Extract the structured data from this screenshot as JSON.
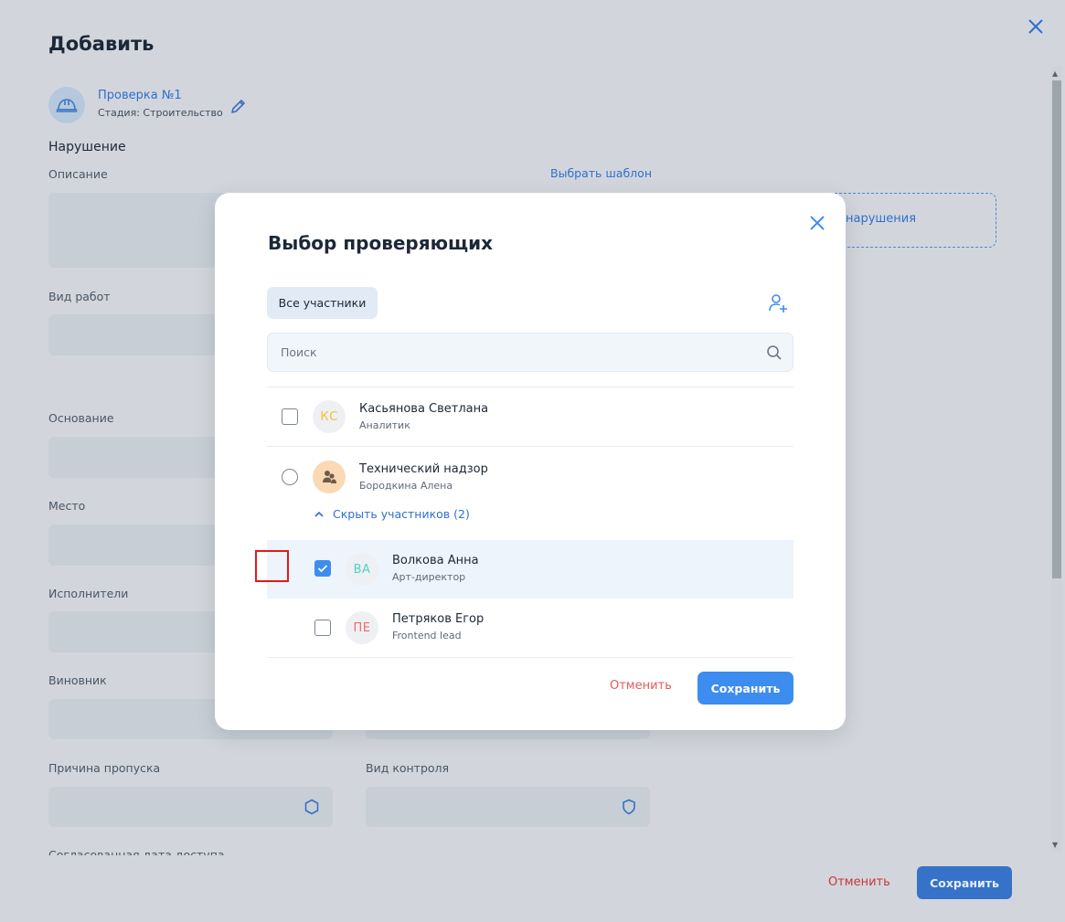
{
  "page": {
    "title": "Добавить",
    "inspection": {
      "title": "Проверка №1",
      "subtitle": "Стадия: Строительство"
    },
    "section_title": "Нарушение",
    "labels": {
      "description": "Описание",
      "work_type": "Вид работ",
      "basis": "Основание",
      "place": "Место",
      "executors": "Исполнители",
      "culprit": "Виновник",
      "skip_reason": "Причина пропуска",
      "control_type": "Вид контроля",
      "agreed_date": "Согласованная дата доступа"
    },
    "template_link": "Выбрать шаблон",
    "violation_photo_link": "нарушения",
    "cancel_label": "Отменить",
    "save_label": "Сохранить"
  },
  "modal": {
    "title": "Выбор проверяющих",
    "tab_all": "Все участники",
    "search_placeholder": "Поиск",
    "items": [
      {
        "initials": "КС",
        "name": "Касьянова Светлана",
        "role": "Аналитик",
        "checked": false,
        "color": "#f2c230"
      },
      {
        "name": "Технический надзор",
        "role": "Бородкина Алена",
        "group": true
      },
      {
        "initials": "ВА",
        "name": "Волкова Анна",
        "role": "Арт-директор",
        "checked": true,
        "color": "#4fd1c1"
      },
      {
        "initials": "ПЕ",
        "name": "Петряков Егор",
        "role": "Frontend lead",
        "checked": false,
        "color": "#ef6b6b"
      }
    ],
    "toggle_label": "Скрыть участников (2)",
    "cancel_label": "Отменить",
    "save_label": "Сохранить"
  },
  "colors": {
    "accent": "#3d8cf0",
    "danger": "#e05a5a",
    "link": "#2f6fcf"
  }
}
